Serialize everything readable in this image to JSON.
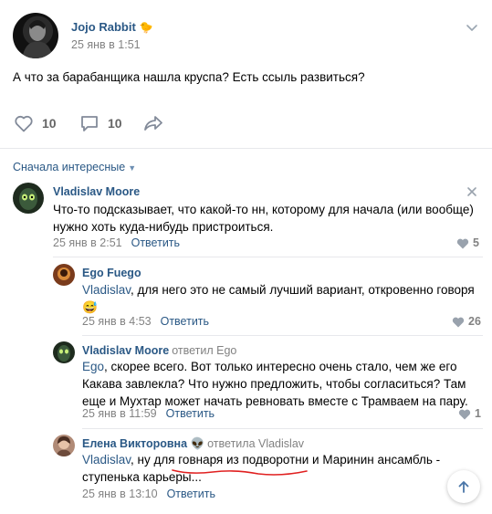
{
  "post": {
    "author": "Jojo Rabbit",
    "author_emoji": "🐤",
    "date": "25 янв в 1:51",
    "text": "А что за барабанщика нашла круспа? Есть ссыль развиться?",
    "likes": "10",
    "comments": "10"
  },
  "comments_sort": "Сначала интересные",
  "comments": [
    {
      "name": "Vladislav Moore",
      "text": "Что-то подсказывает, что какой-то нн, которому для начала (или вообще) нужно хоть куда-нибудь пристроиться.",
      "date": "25 янв в 2:51",
      "reply": "Ответить",
      "likes": "5"
    },
    {
      "name": "Ego Fuego",
      "mention": "Vladislav",
      "text": ", для него это не самый лучший вариант, откровенно говоря",
      "emoji": "😅",
      "date": "25 янв в 4:53",
      "reply": "Ответить",
      "likes": "26"
    },
    {
      "name": "Vladislav Moore",
      "reply_to": "ответил Ego",
      "mention": "Ego",
      "text": ", скорее всего. Вот только интересно очень стало, чем же его Какава завлекла? Что нужно предложить, чтобы согласиться? Там еще и Мухтар может начать ревновать вместе с Трамваем на пару.",
      "date": "25 янв в 11:59",
      "reply": "Ответить",
      "likes": "1"
    },
    {
      "name": "Елена Викторовна",
      "name_emoji": "👽",
      "reply_to": "ответила Vladislav",
      "mention": "Vladislav",
      "text": ", ну для говнаря из подворотни и Маринин ансамбль - ступенька карьеры...",
      "date": "25 янв в 13:10",
      "reply": "Ответить"
    }
  ],
  "colors": {
    "link": "#2a5885",
    "meta": "#828282",
    "divider": "#e7e8ec",
    "underline": "#e02020"
  }
}
